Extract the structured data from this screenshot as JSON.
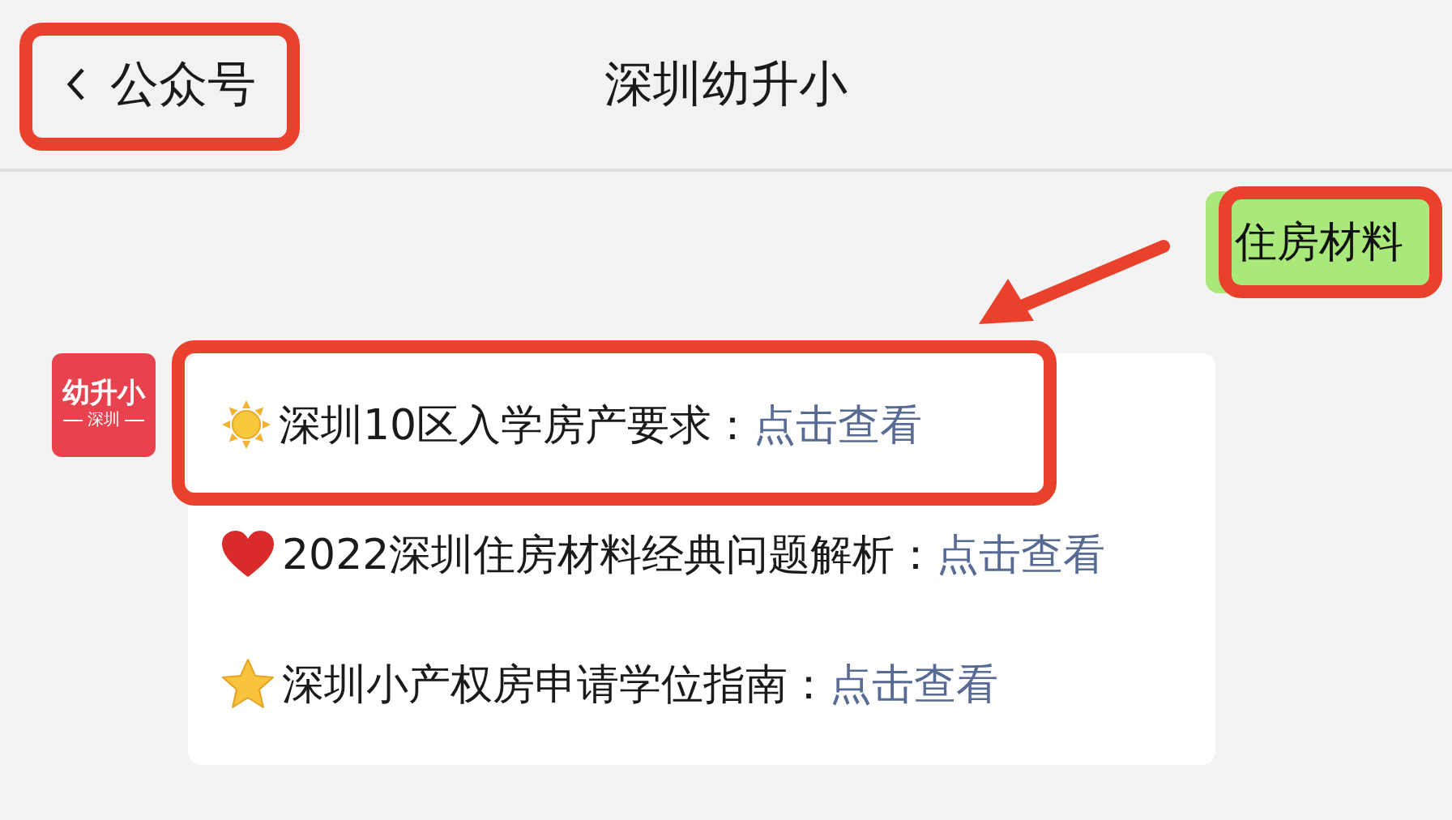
{
  "header": {
    "back": {
      "label": "公众号",
      "highlighted": true
    },
    "title": "深圳幼升小"
  },
  "outgoing_message": {
    "text": "住房材料",
    "highlighted": true
  },
  "incoming": {
    "avatar": {
      "name": "幼升小",
      "city": "深圳"
    },
    "items": [
      {
        "kind": "sun",
        "text": "深圳10区入学房产要求：",
        "link": "点击查看",
        "highlighted": true
      },
      {
        "kind": "heart",
        "text": "2022深圳住房材料经典问题解析：",
        "link": "点击查看",
        "highlighted": false
      },
      {
        "kind": "star",
        "text": "深圳小产权房申请学位指南：",
        "link": "点击查看",
        "highlighted": false
      }
    ]
  }
}
